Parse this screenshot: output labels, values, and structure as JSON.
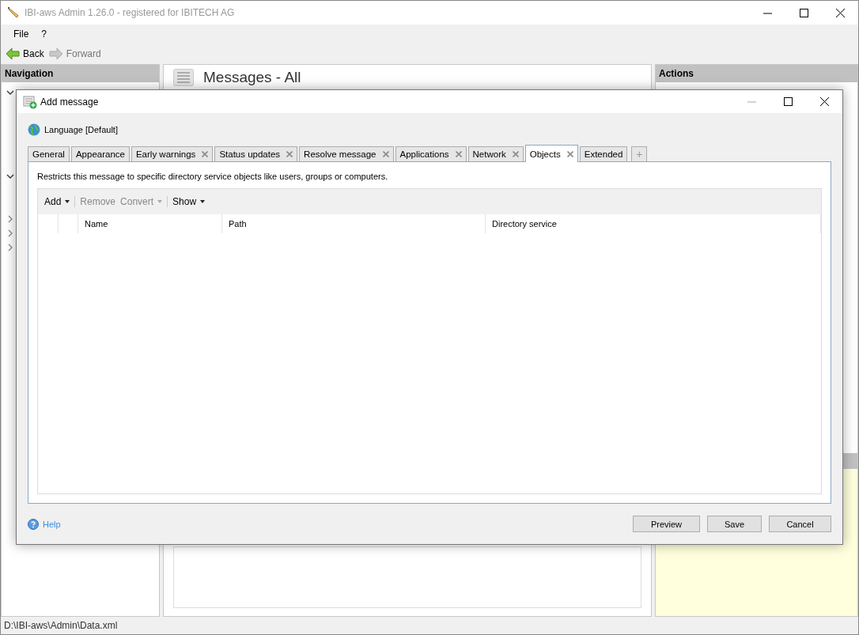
{
  "window": {
    "title": "IBI-aws Admin 1.26.0 - registered for IBITECH AG"
  },
  "menu": [
    {
      "label": "File"
    },
    {
      "label": "?"
    }
  ],
  "toolbar": [
    {
      "label": "Back",
      "disabled": false
    },
    {
      "label": "Forward",
      "disabled": true
    }
  ],
  "navigation": {
    "title": "Navigation"
  },
  "content": {
    "title": "Messages - All"
  },
  "actions": {
    "title": "Actions"
  },
  "dialog": {
    "title": "Add message",
    "language": "Language [Default]",
    "tabs": [
      {
        "label": "General",
        "closable": false,
        "selected": false
      },
      {
        "label": "Appearance",
        "closable": false,
        "selected": false
      },
      {
        "label": "Early warnings",
        "closable": true,
        "selected": false
      },
      {
        "label": "Status updates",
        "closable": true,
        "selected": false
      },
      {
        "label": "Resolve message",
        "closable": true,
        "selected": false
      },
      {
        "label": "Applications",
        "closable": true,
        "selected": false
      },
      {
        "label": "Network",
        "closable": true,
        "selected": false
      },
      {
        "label": "Objects",
        "closable": true,
        "selected": true
      },
      {
        "label": "Extended",
        "closable": false,
        "selected": false
      }
    ],
    "add_tab": "+",
    "description": "Restricts this message to specific directory service objects like users, groups or computers.",
    "object_toolbar": [
      {
        "label": "Add",
        "dropdown": true,
        "disabled": false,
        "separator_after": true
      },
      {
        "label": "Remove",
        "dropdown": false,
        "disabled": true,
        "separator_after": false
      },
      {
        "label": "Convert",
        "dropdown": true,
        "disabled": true,
        "separator_after": true
      },
      {
        "label": "Show",
        "dropdown": true,
        "disabled": false,
        "separator_after": false
      }
    ],
    "table": {
      "columns": [
        "Name",
        "Path",
        "Directory service"
      ]
    },
    "help": "Help",
    "buttons": [
      "Preview",
      "Save",
      "Cancel"
    ]
  },
  "status_bar": "D:\\IBI-aws\\Admin\\Data.xml"
}
